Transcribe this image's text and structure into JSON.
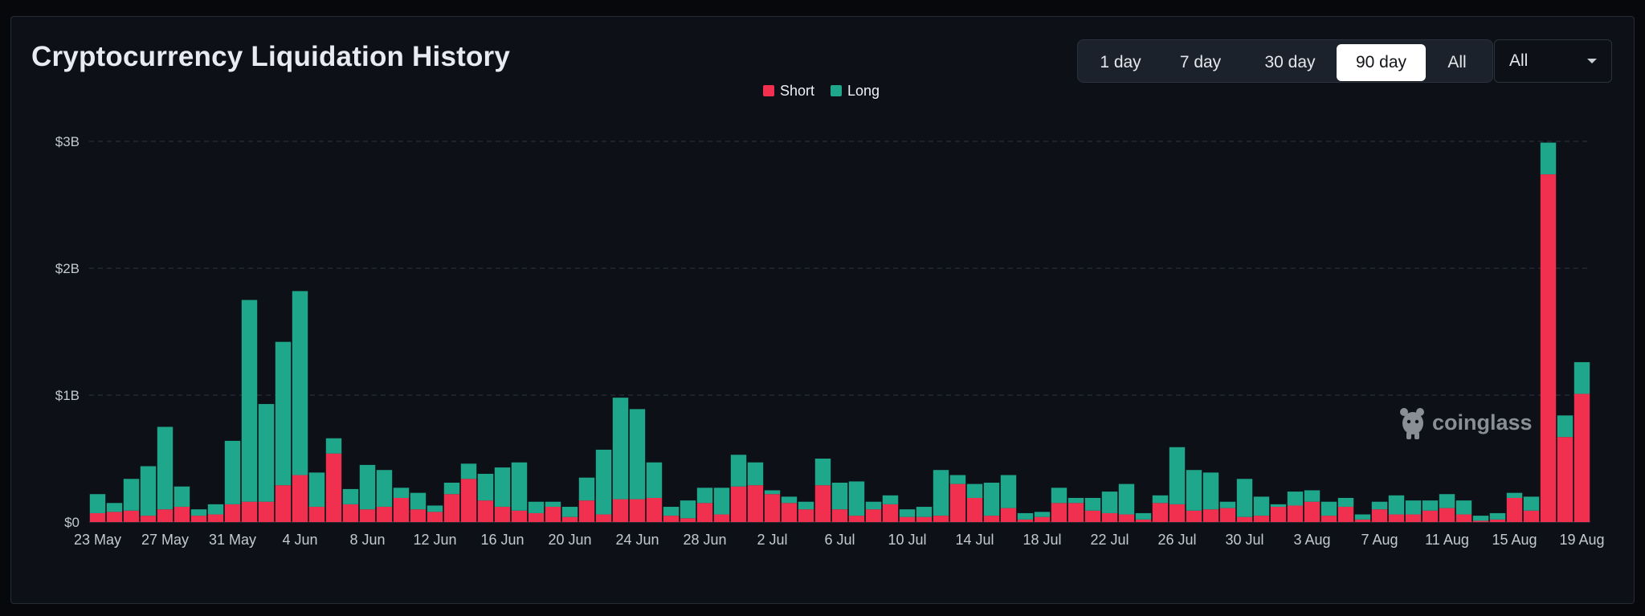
{
  "header": {
    "title": "Cryptocurrency Liquidation History"
  },
  "range_buttons": [
    {
      "label": "1 day",
      "active": false
    },
    {
      "label": "7 day",
      "active": false
    },
    {
      "label": "30 day",
      "active": false
    },
    {
      "label": "90 day",
      "active": true
    },
    {
      "label": "All",
      "active": false
    }
  ],
  "coin_select": {
    "value": "All"
  },
  "watermark": "coinglass",
  "colors": {
    "short": "#f0304e",
    "long": "#1fa78c",
    "grid": "#2e3440",
    "axis_text": "#c4c9d1",
    "background": "#0d1117"
  },
  "chart_data": {
    "type": "bar",
    "stacked": true,
    "title": "Cryptocurrency Liquidation History",
    "xlabel": "",
    "ylabel": "",
    "ylim": [
      0,
      3000000000
    ],
    "y_ticks": [
      0,
      1000000000,
      2000000000,
      3000000000
    ],
    "y_tick_labels": [
      "$0",
      "$1B",
      "$2B",
      "$3B"
    ],
    "x_tick_labels": [
      "23 May",
      "27 May",
      "31 May",
      "4 Jun",
      "8 Jun",
      "12 Jun",
      "16 Jun",
      "20 Jun",
      "24 Jun",
      "28 Jun",
      "2 Jul",
      "6 Jul",
      "10 Jul",
      "14 Jul",
      "18 Jul",
      "22 Jul",
      "26 Jul",
      "30 Jul",
      "3 Aug",
      "7 Aug",
      "11 Aug",
      "15 Aug",
      "19 Aug"
    ],
    "x_tick_every": 4,
    "grid": true,
    "legend_position": "top-center",
    "series": [
      {
        "name": "Short",
        "color": "#f0304e",
        "values": [
          0.07,
          0.08,
          0.09,
          0.05,
          0.1,
          0.12,
          0.05,
          0.06,
          0.14,
          0.16,
          0.16,
          0.29,
          0.37,
          0.12,
          0.54,
          0.14,
          0.1,
          0.12,
          0.19,
          0.1,
          0.08,
          0.22,
          0.34,
          0.17,
          0.12,
          0.09,
          0.07,
          0.12,
          0.04,
          0.17,
          0.06,
          0.18,
          0.18,
          0.19,
          0.05,
          0.03,
          0.15,
          0.06,
          0.28,
          0.29,
          0.22,
          0.15,
          0.1,
          0.29,
          0.1,
          0.05,
          0.1,
          0.14,
          0.04,
          0.04,
          0.05,
          0.3,
          0.19,
          0.05,
          0.11,
          0.02,
          0.04,
          0.15,
          0.15,
          0.09,
          0.07,
          0.06,
          0.02,
          0.15,
          0.14,
          0.09,
          0.1,
          0.11,
          0.04,
          0.05,
          0.12,
          0.13,
          0.16,
          0.05,
          0.12,
          0.02,
          0.1,
          0.06,
          0.06,
          0.09,
          0.11,
          0.06,
          0.01,
          0.02,
          0.19,
          0.09,
          2.74,
          0.67,
          1.01
        ]
      },
      {
        "name": "Long",
        "color": "#1fa78c",
        "values": [
          0.15,
          0.07,
          0.25,
          0.39,
          0.65,
          0.16,
          0.05,
          0.08,
          0.5,
          1.59,
          0.77,
          1.13,
          1.45,
          0.27,
          0.12,
          0.12,
          0.35,
          0.29,
          0.08,
          0.13,
          0.05,
          0.09,
          0.12,
          0.21,
          0.31,
          0.38,
          0.09,
          0.04,
          0.08,
          0.18,
          0.51,
          0.8,
          0.71,
          0.28,
          0.07,
          0.14,
          0.12,
          0.21,
          0.25,
          0.18,
          0.03,
          0.05,
          0.06,
          0.21,
          0.21,
          0.27,
          0.06,
          0.07,
          0.06,
          0.08,
          0.36,
          0.07,
          0.11,
          0.26,
          0.26,
          0.05,
          0.04,
          0.12,
          0.04,
          0.1,
          0.17,
          0.24,
          0.05,
          0.06,
          0.45,
          0.32,
          0.29,
          0.05,
          0.3,
          0.15,
          0.02,
          0.11,
          0.09,
          0.11,
          0.07,
          0.04,
          0.06,
          0.15,
          0.11,
          0.08,
          0.11,
          0.11,
          0.04,
          0.05,
          0.04,
          0.11,
          0.25,
          0.17,
          0.25
        ]
      }
    ],
    "value_unit": "billions USD"
  }
}
